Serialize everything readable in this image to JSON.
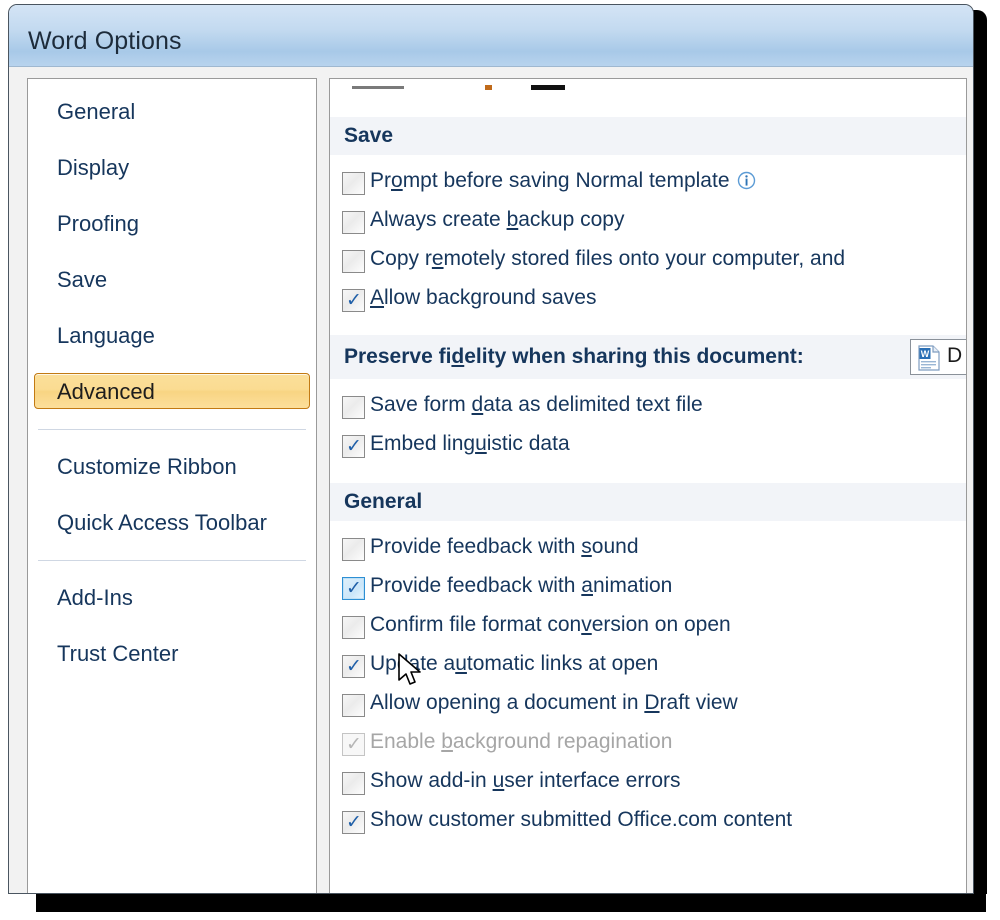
{
  "window": {
    "title": "Word Options"
  },
  "sidebar": {
    "items": [
      {
        "label": "General",
        "selected": false
      },
      {
        "label": "Display",
        "selected": false
      },
      {
        "label": "Proofing",
        "selected": false
      },
      {
        "label": "Save",
        "selected": false
      },
      {
        "label": "Language",
        "selected": false
      },
      {
        "label": "Advanced",
        "selected": true
      },
      {
        "label": "Customize Ribbon",
        "selected": false
      },
      {
        "label": "Quick Access Toolbar",
        "selected": false
      },
      {
        "label": "Add-Ins",
        "selected": false
      },
      {
        "label": "Trust Center",
        "selected": false
      }
    ]
  },
  "content": {
    "save_section": {
      "header": "Save",
      "options": [
        {
          "label_before": "Pr",
          "accel": "o",
          "label_after": "mpt before saving Normal template",
          "checked": false,
          "info": true
        },
        {
          "label_before": "Always create ",
          "accel": "b",
          "label_after": "ackup copy",
          "checked": false,
          "info": false
        },
        {
          "label_before": "Copy r",
          "accel": "e",
          "label_after": "motely stored files onto your computer, and",
          "checked": false,
          "info": false
        },
        {
          "label_before": "",
          "accel": "A",
          "label_after": "llow background saves",
          "checked": true,
          "info": false
        }
      ]
    },
    "fidelity": {
      "label_before": "Preserve fi",
      "accel": "d",
      "label_after": "elity when sharing this document:",
      "combo_value": "D",
      "combo_icon": "word-document-icon"
    },
    "fidelity_options": [
      {
        "label_before": "Save form ",
        "accel": "d",
        "label_after": "ata as delimited text file",
        "checked": false
      },
      {
        "label_before": "Embed ling",
        "accel": "u",
        "label_after": "istic data",
        "checked": true
      }
    ],
    "general_section": {
      "header": "General",
      "options": [
        {
          "label_before": "Provide feedback with ",
          "accel": "s",
          "label_after": "ound",
          "checked": false,
          "hover": false,
          "disabled": false
        },
        {
          "label_before": "Provide feedback with ",
          "accel": "a",
          "label_after": "nimation",
          "checked": true,
          "hover": true,
          "disabled": false
        },
        {
          "label_before": "Confirm file format con",
          "accel": "v",
          "label_after": "ersion on open",
          "checked": false,
          "hover": false,
          "disabled": false
        },
        {
          "label_before": "Update a",
          "accel": "u",
          "label_after": "tomatic links at open",
          "checked": true,
          "hover": false,
          "disabled": false
        },
        {
          "label_before": "Allow opening a document in ",
          "accel": "D",
          "label_after": "raft view",
          "checked": false,
          "hover": false,
          "disabled": false
        },
        {
          "label_before": "Enable ",
          "accel": "b",
          "label_after": "ackground repagination",
          "checked": true,
          "hover": false,
          "disabled": true
        },
        {
          "label_before": "Show add-in ",
          "accel": "u",
          "label_after": "ser interface errors",
          "checked": false,
          "hover": false,
          "disabled": false
        },
        {
          "label_before": "Show customer submitted Office.com content",
          "accel": "",
          "label_after": "",
          "checked": true,
          "hover": false,
          "disabled": false
        }
      ]
    }
  },
  "colors": {
    "accent_selected_border": "#c27a13",
    "accent_selected_fill": "#fbdf9a",
    "label_blue": "#16365c",
    "check_blue": "#1f5fa8",
    "titlebar_blue": "#a8c9e8"
  }
}
